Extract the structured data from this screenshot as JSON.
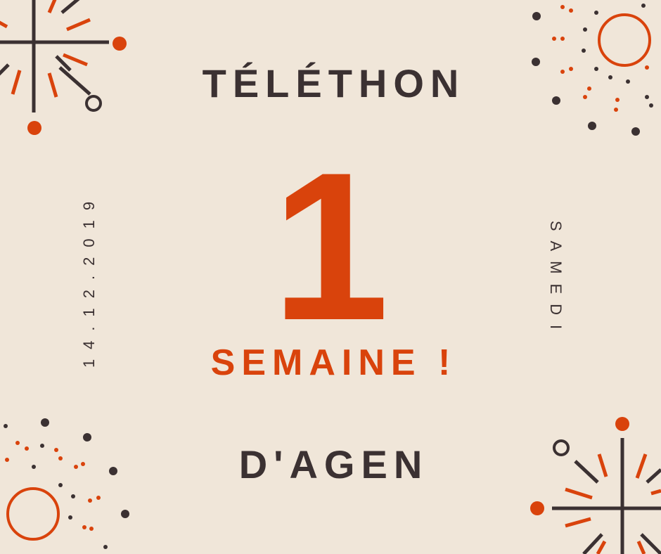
{
  "poster": {
    "title_top": "TÉLÉTHON",
    "number": "1",
    "subtitle": "SEMAINE !",
    "title_bottom": "D'AGEN",
    "date": "14.12.2019",
    "day": "SAMEDI"
  },
  "colors": {
    "background": "#f0e6d9",
    "dark": "#3b3132",
    "accent": "#d9430c"
  },
  "decorations": [
    "firework-starburst-icon",
    "firework-ring-icon"
  ]
}
